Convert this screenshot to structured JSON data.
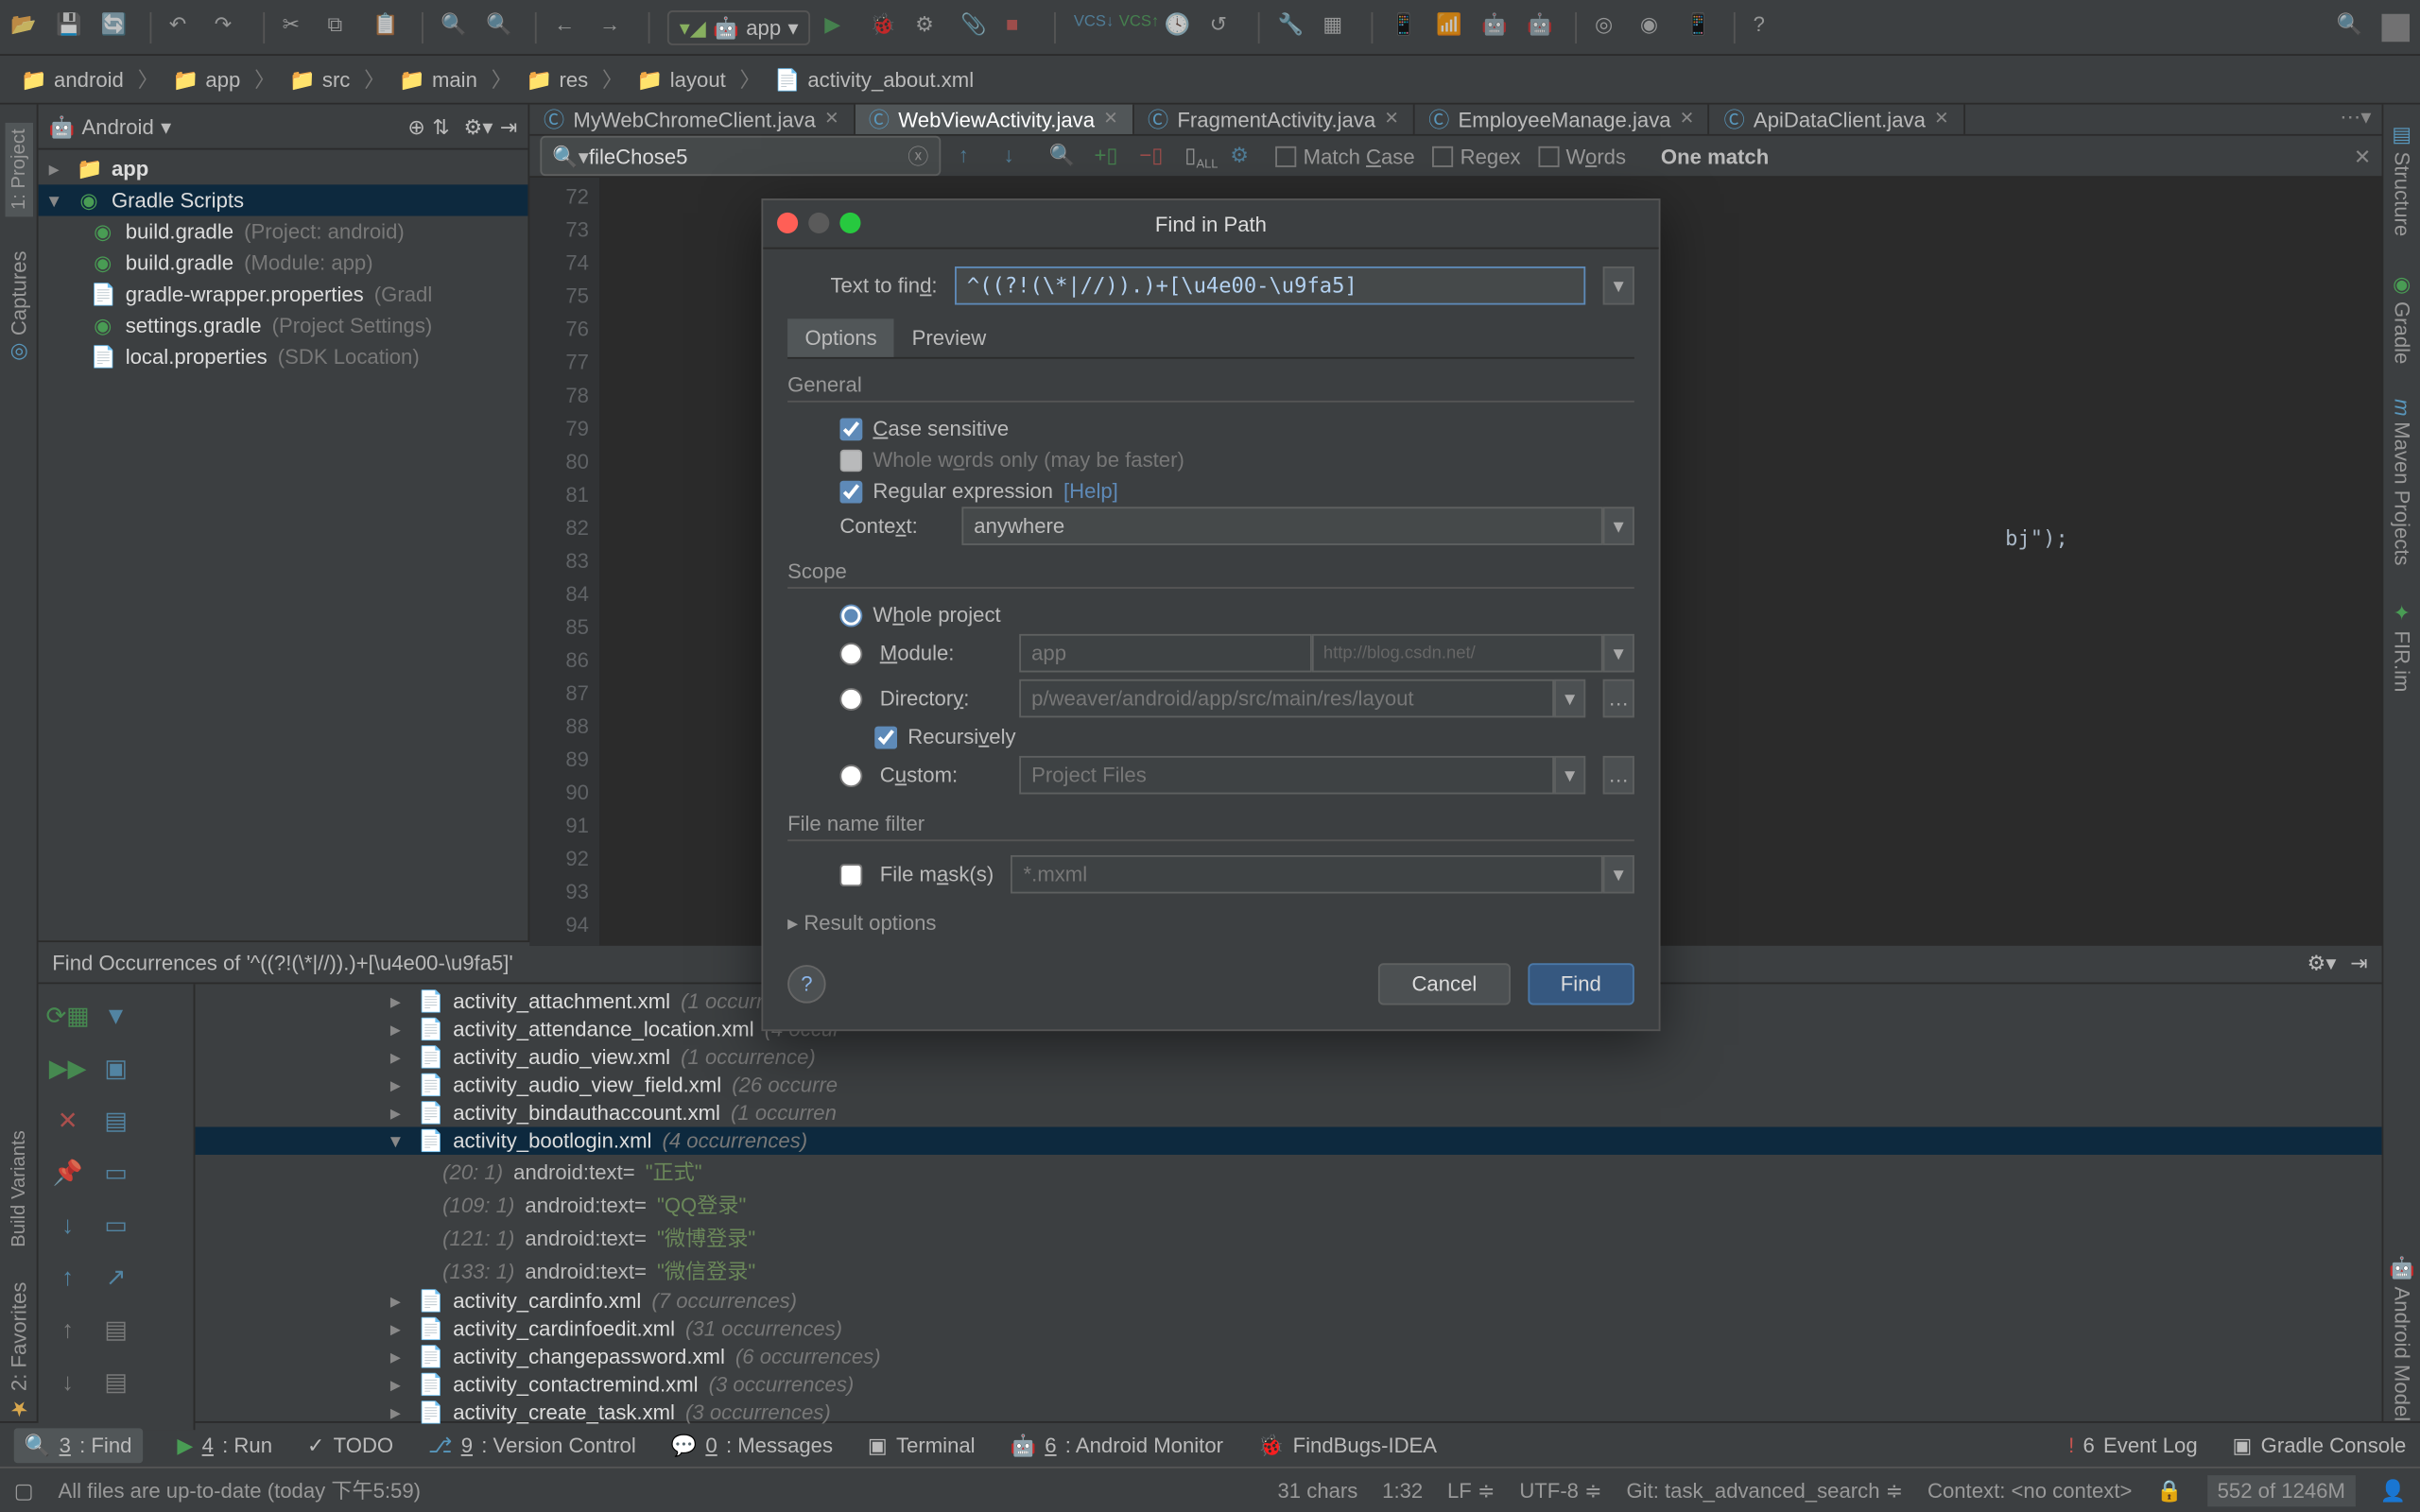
{
  "toolbar": {
    "run_config_label": "app"
  },
  "breadcrumb": [
    "android",
    "app",
    "src",
    "main",
    "res",
    "layout",
    "activity_about.xml"
  ],
  "project": {
    "view_label": "Android",
    "root": "app",
    "gradle_scripts_label": "Gradle Scripts",
    "nodes": [
      {
        "label": "build.gradle",
        "hint": "(Project: android)"
      },
      {
        "label": "build.gradle",
        "hint": "(Module: app)"
      },
      {
        "label": "gradle-wrapper.properties",
        "hint": "(Gradl"
      },
      {
        "label": "settings.gradle",
        "hint": "(Project Settings)"
      },
      {
        "label": "local.properties",
        "hint": "(SDK Location)"
      }
    ]
  },
  "tabs": [
    {
      "label": "MyWebChromeClient.java",
      "active": false
    },
    {
      "label": "WebViewActivity.java",
      "active": true
    },
    {
      "label": "FragmentActivity.java",
      "active": false
    },
    {
      "label": "EmployeeManage.java",
      "active": false
    },
    {
      "label": "ApiDataClient.java",
      "active": false
    }
  ],
  "searchbar": {
    "value": "fileChose5",
    "match_case": "Match Case",
    "regex": "Regex",
    "words": "Words",
    "result": "One match"
  },
  "editor": {
    "line_start": 72,
    "line_end": 94,
    "fragment": "bj\");"
  },
  "find_panel": {
    "title": "Find Occurrences of '^((?!(\\*|//)).)+[\\u4e00-\\u9fa5]'",
    "files": [
      {
        "name": "activity_attachment.xml",
        "count": "(1 occurrence)"
      },
      {
        "name": "activity_attendance_location.xml",
        "count": "(4 occur"
      },
      {
        "name": "activity_audio_view.xml",
        "count": "(1 occurrence)"
      },
      {
        "name": "activity_audio_view_field.xml",
        "count": "(26 occurre"
      },
      {
        "name": "activity_bindauthaccount.xml",
        "count": "(1 occurren"
      },
      {
        "name": "activity_bootlogin.xml",
        "count": "(4 occurrences)",
        "expanded": true,
        "children": [
          {
            "loc": "(20: 1)",
            "attr": "android:text=",
            "val": "\"正式\""
          },
          {
            "loc": "(109: 1)",
            "attr": "android:text=",
            "val": "\"QQ登录\""
          },
          {
            "loc": "(121: 1)",
            "attr": "android:text=",
            "val": "\"微博登录\""
          },
          {
            "loc": "(133: 1)",
            "attr": "android:text=",
            "val": "\"微信登录\""
          }
        ]
      },
      {
        "name": "activity_cardinfo.xml",
        "count": "(7 occurrences)"
      },
      {
        "name": "activity_cardinfoedit.xml",
        "count": "(31 occurrences)"
      },
      {
        "name": "activity_changepassword.xml",
        "count": "(6 occurrences)"
      },
      {
        "name": "activity_contactremind.xml",
        "count": "(3 occurrences)"
      },
      {
        "name": "activity_create_task.xml",
        "count": "(3 occurrences)"
      }
    ]
  },
  "toolwin": {
    "find": "3: Find",
    "run": "4: Run",
    "todo": "TODO",
    "vcs": "9: Version Control",
    "messages": "0: Messages",
    "terminal": "Terminal",
    "android_monitor": "6: Android Monitor",
    "findbugs": "FindBugs-IDEA",
    "event_log": "Event Log",
    "gradle_console": "Gradle Console"
  },
  "status": {
    "msg": "All files are up-to-date (today 下午5:59)",
    "chars": "31 chars",
    "pos": "1:32",
    "le": "LF",
    "enc": "UTF-8",
    "git": "Git: task_advanced_search",
    "context": "Context: <no context>",
    "mem": "552 of 1246M"
  },
  "dialog": {
    "title": "Find in Path",
    "text_to_find_label": "Text to find:",
    "text_to_find_value": "^((?!(\\*|//)).)+[\\u4e00-\\u9fa5]",
    "tab_options": "Options",
    "tab_preview": "Preview",
    "section_general": "General",
    "case_sensitive": "Case sensitive",
    "whole_words": "Whole words only (may be faster)",
    "regex": "Regular expression",
    "help_link": "[Help]",
    "context_label": "Context:",
    "context_value": "anywhere",
    "section_scope": "Scope",
    "whole_project": "Whole project",
    "module_label": "Module:",
    "module_value": "app",
    "module_watermark": "http://blog.csdn.net/",
    "directory_label": "Directory:",
    "directory_value": "p/weaver/android/app/src/main/res/layout",
    "recursively": "Recursively",
    "custom_label": "Custom:",
    "custom_value": "Project Files",
    "section_filemask": "File name filter",
    "filemask_label": "File mask(s)",
    "filemask_value": "*.mxml",
    "section_result": "Result options",
    "cancel": "Cancel",
    "find": "Find"
  },
  "side_tabs": {
    "left": [
      "1: Project",
      "Captures"
    ],
    "right": [
      "Structure",
      "Gradle",
      "Maven Projects",
      "FIR.im"
    ],
    "bottom_left": [
      "Build Variants",
      "2: Favorites"
    ],
    "right2": [
      "Android Model"
    ]
  }
}
